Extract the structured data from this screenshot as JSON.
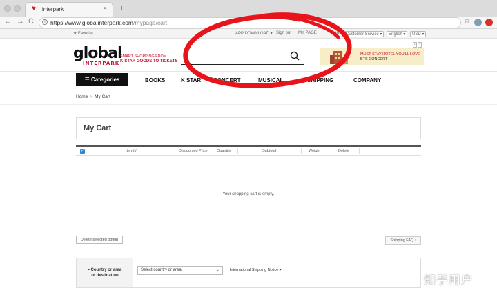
{
  "browser": {
    "tab_title": "interpark",
    "tab_close": "×",
    "new_tab": "+",
    "url_host": "https://www.globalinterpark.com",
    "url_path": "/mypage/cart",
    "back": "←",
    "forward": "→",
    "reload": "C"
  },
  "utility": {
    "favorite": "Favorite",
    "app_download": "APP DOWNLOAD",
    "sign_out": "Sign out",
    "my_page": "MY PAGE",
    "cart": "Cart",
    "customer_service": "Customer Service",
    "language": "English",
    "currency": "USD"
  },
  "header": {
    "logo_main": "global",
    "logo_sub": "INTERPARK",
    "slogan_line1": "SMART SHOPPING FROM",
    "slogan_line2": "K-STAR GOODS TO TICKETS",
    "search_placeholder": "",
    "banner_line1": "MUST-STAY HOTEL YOU'LL LOVE",
    "banner_line2": "BTS CONCERT",
    "banner_prev": "‹",
    "banner_next": "›"
  },
  "nav": {
    "categories": "☰ Categories",
    "items": [
      "BOOKS",
      "K STAR",
      "CONCERT",
      "MUSICAL",
      "SHIPPING",
      "COMPANY"
    ]
  },
  "breadcrumb": {
    "home": "Home",
    "sep": ">",
    "current": "My Cart"
  },
  "cart": {
    "title": "My Cart",
    "columns": [
      "Item(s)",
      "Discounted Price",
      "Quantity",
      "Subtotal",
      "Weight",
      "Delete"
    ],
    "empty_message": "Your shopping cart is empty.",
    "delete_selected": "Delete selected option",
    "shipping_faq": "Shipping FAQ"
  },
  "shipping": {
    "label_line1": "Country or area",
    "label_line2": "of destination",
    "select_value": "Select country or area",
    "notice": "International Shipping Notice"
  },
  "watermark": "知乎用户",
  "colors": {
    "brand_red": "#c8102e",
    "annotation_red": "#e8141c",
    "checkbox_blue": "#2c84d3"
  }
}
